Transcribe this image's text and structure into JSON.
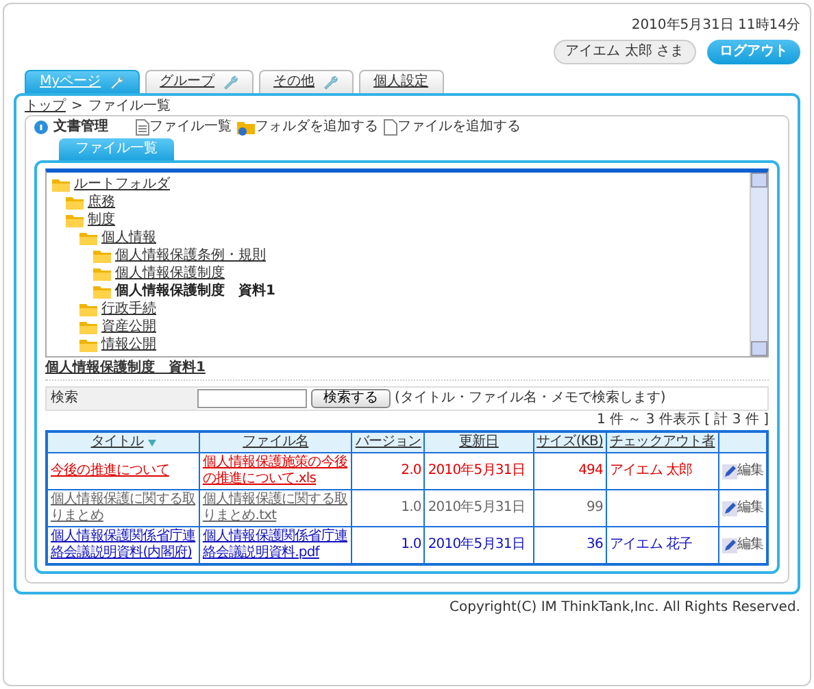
{
  "header": {
    "datetime": "2010年5月31日  11時14分",
    "user": "アイエム 太郎 さま",
    "logout": "ログアウト"
  },
  "tabs": [
    {
      "label": "Myページ",
      "selected": true,
      "wrench": true
    },
    {
      "label": "グループ",
      "selected": false,
      "wrench": true
    },
    {
      "label": "その他",
      "selected": false,
      "wrench": true
    },
    {
      "label": "個人設定",
      "selected": false,
      "wrench": false
    }
  ],
  "breadcrumb": {
    "link": "トップ",
    "separator": ">",
    "current": "ファイル一覧"
  },
  "toolbar": {
    "title": "文書管理",
    "actions": [
      {
        "label": "ファイル一覧",
        "kind": "list"
      },
      {
        "label": "フォルダを追加する",
        "kind": "folder"
      },
      {
        "label": "ファイルを追加する",
        "kind": "file"
      }
    ]
  },
  "panel_tab": "ファイル一覧",
  "tree": [
    {
      "label": "ルートフォルダ",
      "selected": false,
      "children": [
        {
          "label": "庶務",
          "selected": false
        },
        {
          "label": "制度",
          "selected": false,
          "children": [
            {
              "label": "個人情報",
              "selected": false,
              "children": [
                {
                  "label": "個人情報保護条例・規則",
                  "selected": false
                },
                {
                  "label": "個人情報保護制度",
                  "selected": false
                },
                {
                  "label": "個人情報保護制度　資料1",
                  "selected": true
                }
              ]
            },
            {
              "label": "行政手続",
              "selected": false
            },
            {
              "label": "資産公開",
              "selected": false
            },
            {
              "label": "情報公開",
              "selected": false
            }
          ]
        }
      ]
    }
  ],
  "folder_title": "個人情報保護制度　資料1",
  "search": {
    "label": "検索",
    "button": "検索する",
    "hint": "(タイトル・ファイル名・メモで検索します)"
  },
  "count": "1 件 ～ 3 件表示 [ 計 3 件 ]",
  "table": {
    "columns": [
      {
        "label": "タイトル",
        "sorted": true
      },
      {
        "label": "ファイル名",
        "sorted": false
      },
      {
        "label": "バージョン",
        "sorted": false
      },
      {
        "label": "更新日",
        "sorted": false
      },
      {
        "label": "サイズ(KB)",
        "sorted": false
      },
      {
        "label": "チェックアウト者",
        "sorted": false
      }
    ],
    "rows": [
      {
        "title": "今後の推進について",
        "file": "個人情報保護施策の今後の推進について.xls",
        "version": "2.0",
        "date": "2010年5月31日",
        "size": "494",
        "checkout": "アイエム 太郎",
        "edit": "編集",
        "color": "#e00000"
      },
      {
        "title": "個人情報保護に関する取りまとめ",
        "file": "個人情報保護に関する取りまとめ.txt",
        "version": "1.0",
        "date": "2010年5月31日",
        "size": "99",
        "edit": "編集",
        "color": "#666666"
      },
      {
        "title": "個人情報保護関係省庁連絡会議説明資料(内閣府)",
        "file": "個人情報保護関係省庁連絡会議説明資料.pdf",
        "version": "1.0",
        "date": "2010年5月31日",
        "size": "36",
        "checkout": "アイエム 花子",
        "edit": "編集",
        "color": "#1010c0"
      }
    ]
  },
  "footer": "Copyright(C) IM ThinkTank,Inc. All Rights Reserved."
}
